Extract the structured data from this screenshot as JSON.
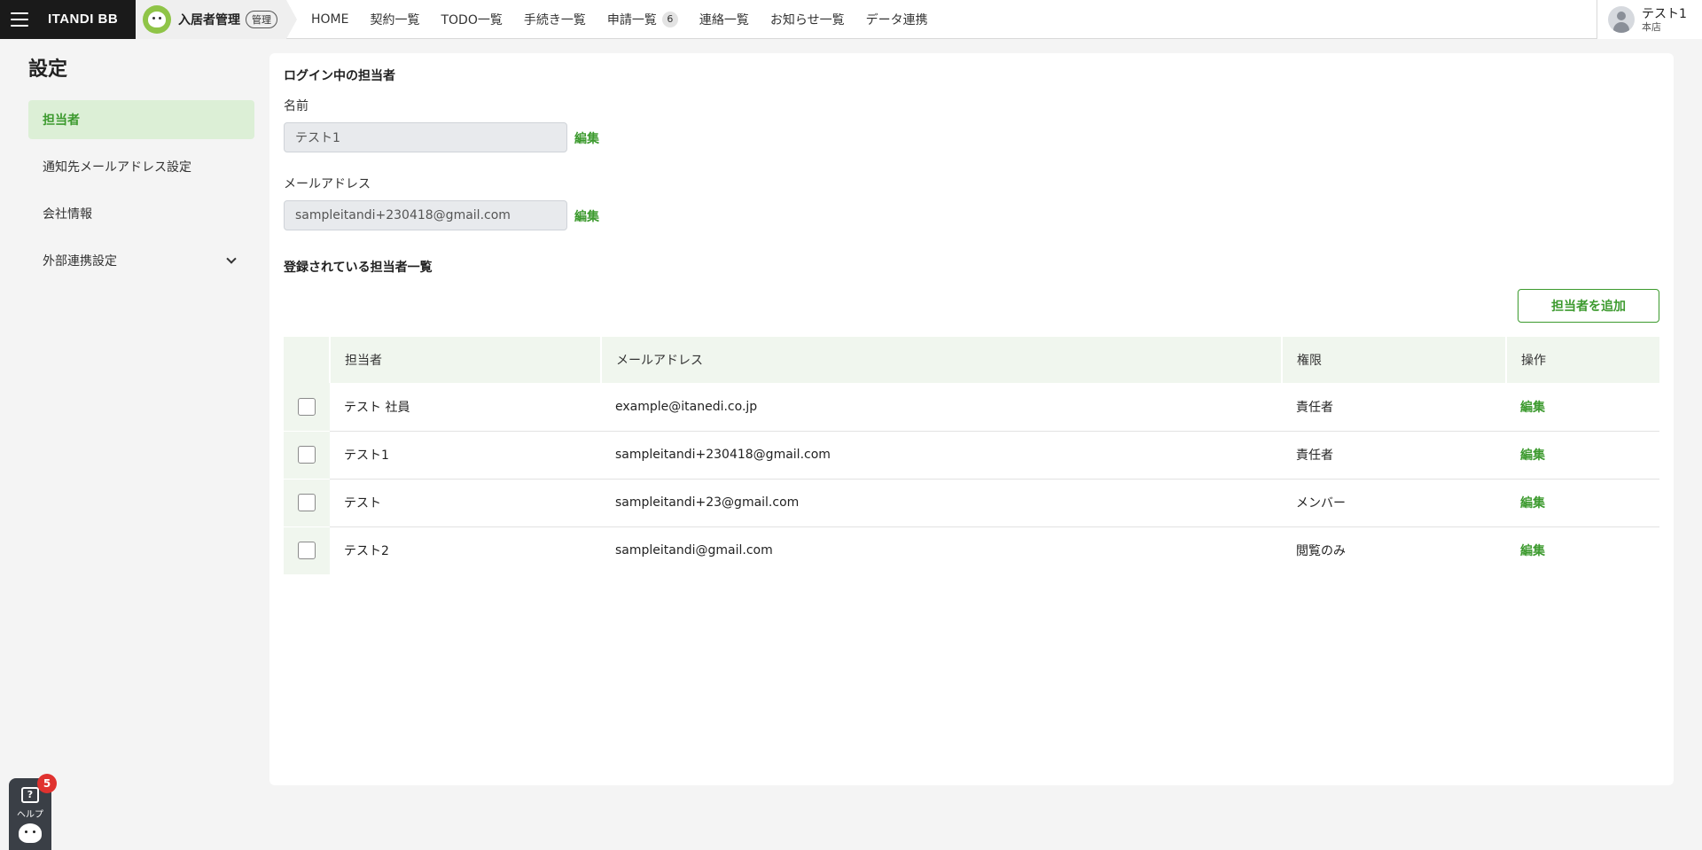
{
  "header": {
    "brand": "ITANDI BB",
    "product_name": "入居者管理",
    "admin_badge": "管理",
    "nav": [
      {
        "label": "HOME"
      },
      {
        "label": "契約一覧"
      },
      {
        "label": "TODO一覧"
      },
      {
        "label": "手続き一覧"
      },
      {
        "label": "申請一覧",
        "badge": "6"
      },
      {
        "label": "連絡一覧"
      },
      {
        "label": "お知らせ一覧"
      },
      {
        "label": "データ連携"
      }
    ],
    "user": {
      "name": "テスト1",
      "store": "本店"
    }
  },
  "sidebar": {
    "title": "設定",
    "items": [
      {
        "label": "担当者",
        "active": true
      },
      {
        "label": "通知先メールアドレス設定"
      },
      {
        "label": "会社情報"
      },
      {
        "label": "外部連携設定",
        "expandable": true
      }
    ]
  },
  "main": {
    "logged_in_title": "ログイン中の担当者",
    "name_label": "名前",
    "name_value": "テスト1",
    "email_label": "メールアドレス",
    "email_value": "sampleitandi+230418@gmail.com",
    "edit_label": "編集",
    "list_title": "登録されている担当者一覧",
    "add_button": "担当者を追加",
    "table": {
      "headers": [
        "担当者",
        "メールアドレス",
        "権限",
        "操作"
      ],
      "rows": [
        {
          "name": "テスト 社員",
          "email": "example@itanedi.co.jp",
          "role": "責任者",
          "action": "編集"
        },
        {
          "name": "テスト1",
          "email": "sampleitandi+230418@gmail.com",
          "role": "責任者",
          "action": "編集"
        },
        {
          "name": "テスト",
          "email": "sampleitandi+23@gmail.com",
          "role": "メンバー",
          "action": "編集"
        },
        {
          "name": "テスト2",
          "email": "sampleitandi@gmail.com",
          "role": "閲覧のみ",
          "action": "編集"
        }
      ]
    }
  },
  "help": {
    "label": "ヘルプ",
    "count": "5"
  },
  "colors": {
    "accent": "#3c9a2e",
    "active_bg": "#dcefd6",
    "header_dark": "#1a1a1a",
    "notification": "#e0322f"
  }
}
